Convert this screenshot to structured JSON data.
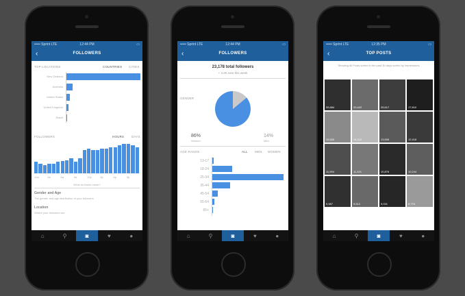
{
  "colors": {
    "accent": "#1f5f9c",
    "bar": "#4a90e2",
    "background": "#4a4a4a"
  },
  "status": {
    "carrier": "••••• Sprint LTE",
    "battery": "▭"
  },
  "phones": [
    {
      "time": "12:44 PM",
      "title": "FOLLOWERS",
      "top_locations_label": "TOP LOCATIONS",
      "top_loc_tabs": [
        "COUNTRIES",
        "CITIES"
      ],
      "locations": [
        {
          "name": "New Zealand",
          "value": 100
        },
        {
          "name": "Australia",
          "value": 8
        },
        {
          "name": "United States",
          "value": 5
        },
        {
          "name": "United Kingdom",
          "value": 3
        },
        {
          "name": "Brazil",
          "value": 1
        }
      ],
      "followers_label": "FOLLOWERS",
      "followers_tabs": [
        "HOURS",
        "DAYS"
      ],
      "hour_values": [
        14,
        12,
        10,
        12,
        12,
        14,
        15,
        16,
        18,
        14,
        18,
        28,
        30,
        28,
        28,
        30,
        30,
        32,
        32,
        34,
        36,
        36,
        34,
        32
      ],
      "x_ticks": [
        "12a",
        "3a",
        "6a",
        "9a",
        "12p",
        "3p",
        "6p",
        "9p"
      ],
      "what_link": "What do these mean?",
      "gender_title": "Gender and Age",
      "gender_sub": "The gender and age distribution of your followers",
      "location_title": "Location",
      "location_sub": "Where your followers are"
    },
    {
      "time": "12:44 PM",
      "title": "FOLLOWERS",
      "total": "23,178 total followers",
      "new_week": "+ 3.2K new this week",
      "gender_label": "GENDER",
      "pie": {
        "women": 86,
        "men": 14
      },
      "women_pct": "86%",
      "women_label": "Women",
      "men_pct": "14%",
      "men_label": "Men",
      "age_label": "AGE RANGE",
      "age_tabs": [
        "ALL",
        "MEN",
        "WOMEN"
      ],
      "ages": [
        {
          "range": "13-17",
          "value": 2
        },
        {
          "range": "18-24",
          "value": 28
        },
        {
          "range": "25-34",
          "value": 100
        },
        {
          "range": "35-44",
          "value": 25
        },
        {
          "range": "45-54",
          "value": 8
        },
        {
          "range": "55-64",
          "value": 3
        },
        {
          "range": "65+",
          "value": 1
        }
      ]
    },
    {
      "time": "12:35 PM",
      "title": "TOP POSTS",
      "info": "Showing All Posts sorted in the past 30 days sorted by Impressions",
      "photos": [
        {
          "color": "#2f2f2f",
          "count": "39,884"
        },
        {
          "color": "#6b6b6b",
          "count": "20,442"
        },
        {
          "color": "#3d3d3d",
          "count": "25,617"
        },
        {
          "color": "#1e1e1e",
          "count": "17,810"
        },
        {
          "color": "#8a8a8a",
          "count": "15,520"
        },
        {
          "color": "#b9b9b9",
          "count": "14,212"
        },
        {
          "color": "#5a5a5a",
          "count": "13,905"
        },
        {
          "color": "#3a3a3a",
          "count": "12,418"
        },
        {
          "color": "#4e4e4e",
          "count": "11,994"
        },
        {
          "color": "#787878",
          "count": "11,321"
        },
        {
          "color": "#2a2a2a",
          "count": "10,876"
        },
        {
          "color": "#5e5e5e",
          "count": "10,244"
        },
        {
          "color": "#303030",
          "count": "9,987"
        },
        {
          "color": "#696969",
          "count": "9,512"
        },
        {
          "color": "#262626",
          "count": "9,031"
        },
        {
          "color": "#9a9a9a",
          "count": "8,776"
        }
      ]
    }
  ],
  "tab_icons": [
    "home-icon",
    "search-icon",
    "insights-icon",
    "activity-icon",
    "profile-icon"
  ]
}
